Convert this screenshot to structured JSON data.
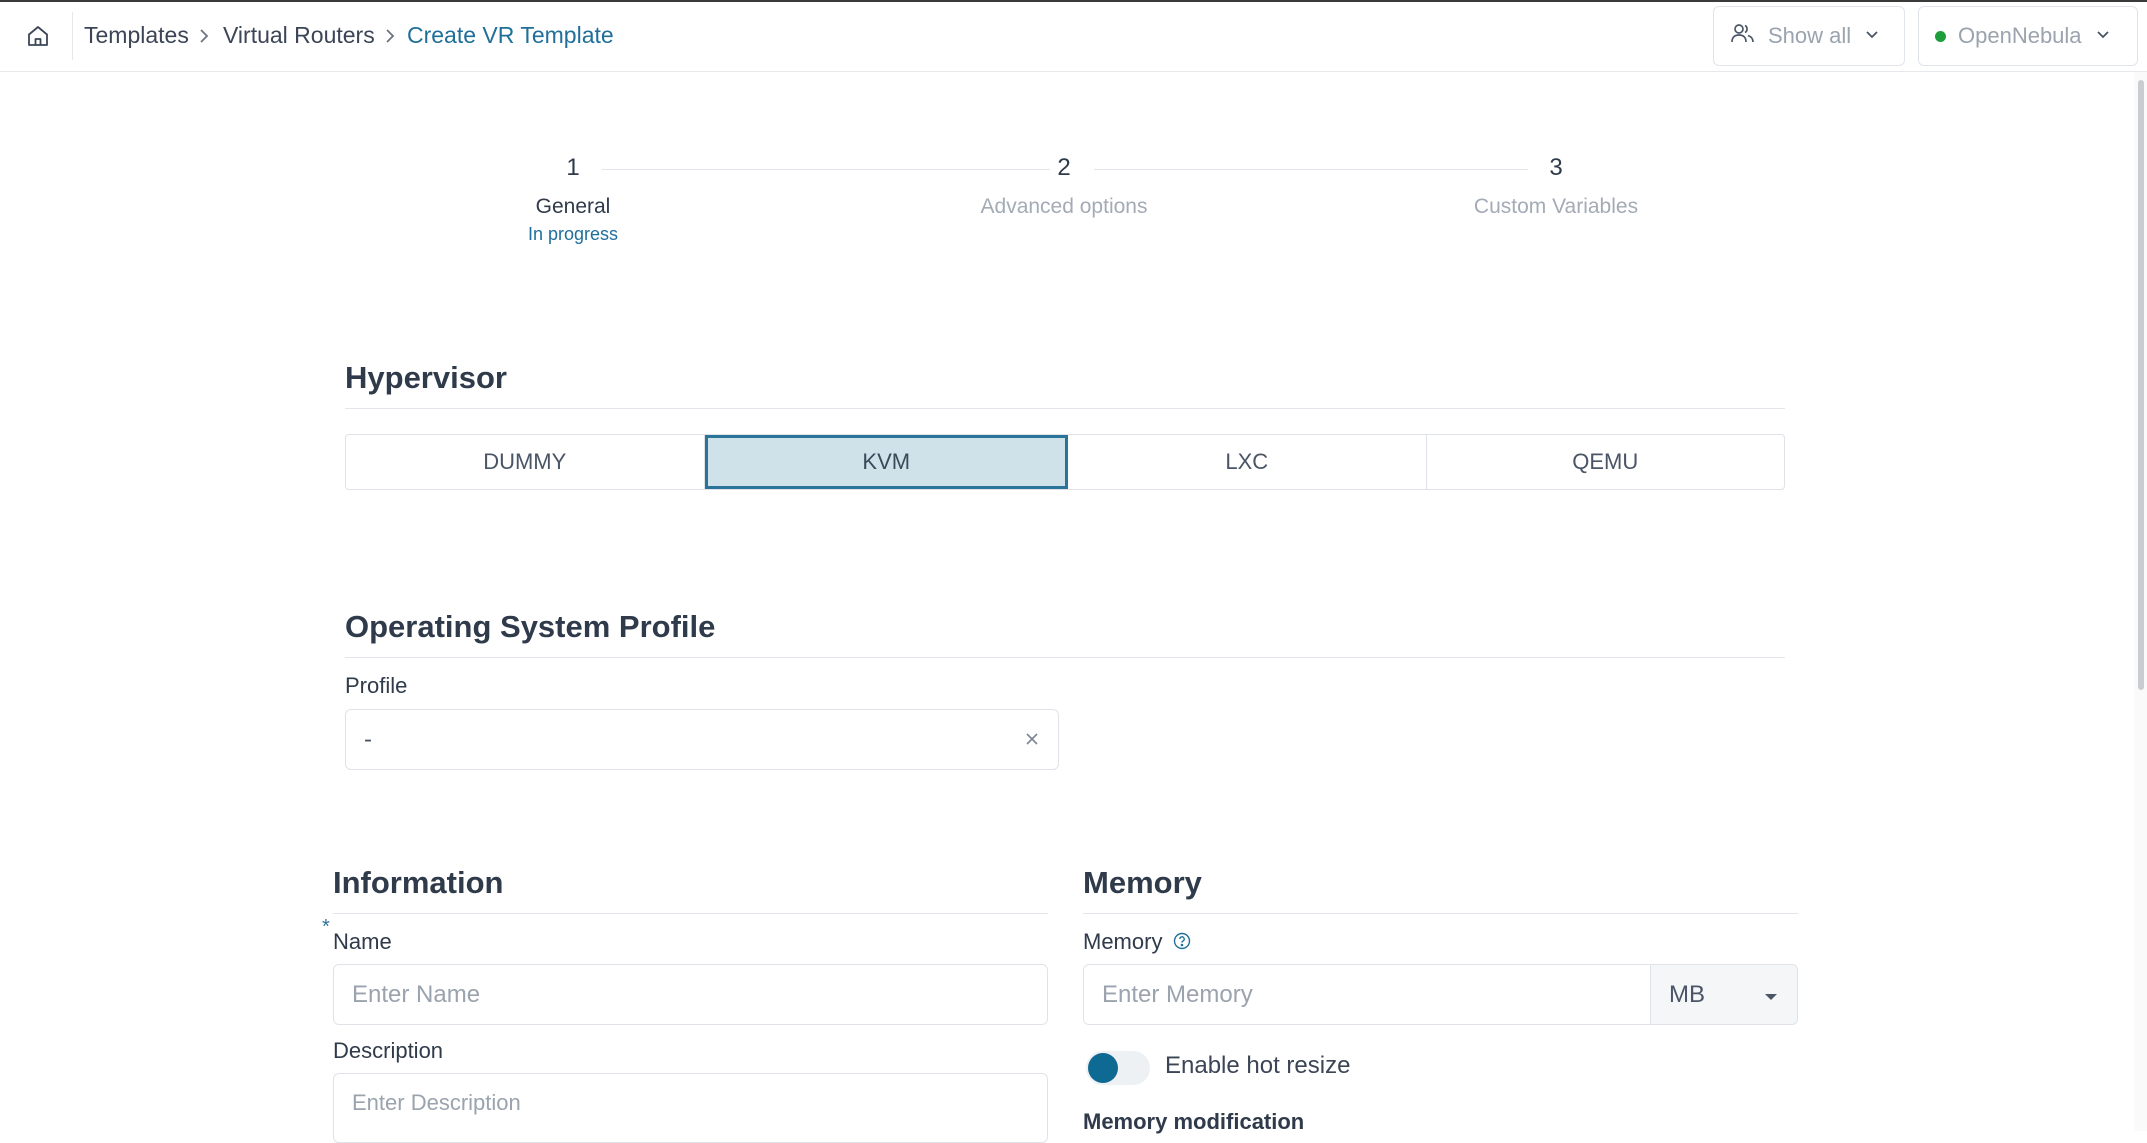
{
  "breadcrumb": {
    "items": [
      "Templates",
      "Virtual Routers",
      "Create VR Template"
    ]
  },
  "top": {
    "group_select": {
      "label": "Show all",
      "icon": "users-icon"
    },
    "zone_select": {
      "label": "OpenNebula",
      "status_color": "#1e9e3b"
    }
  },
  "stepper": {
    "steps": [
      {
        "number": "1",
        "label": "General",
        "status": "In progress"
      },
      {
        "number": "2",
        "label": "Advanced options"
      },
      {
        "number": "3",
        "label": "Custom Variables"
      }
    ]
  },
  "hypervisor": {
    "title": "Hypervisor",
    "options": [
      "DUMMY",
      "KVM",
      "LXC",
      "QEMU"
    ],
    "selected": "KVM"
  },
  "os_profile": {
    "title": "Operating System Profile",
    "profile_label": "Profile",
    "profile_value": "-"
  },
  "information": {
    "title": "Information",
    "required_mark": "*",
    "name_label": "Name",
    "name_placeholder": "Enter Name",
    "description_label": "Description",
    "description_placeholder": "Enter Description"
  },
  "memory": {
    "title": "Memory",
    "memory_label": "Memory",
    "memory_placeholder": "Enter Memory",
    "unit": "MB",
    "hot_resize_label": "Enable hot resize",
    "hot_resize_enabled": false,
    "modification_label": "Memory modification"
  },
  "colors": {
    "accent": "#1f6f9a",
    "selected_bg": "#cfe2ea",
    "toggle_knob": "#0f6a93"
  }
}
